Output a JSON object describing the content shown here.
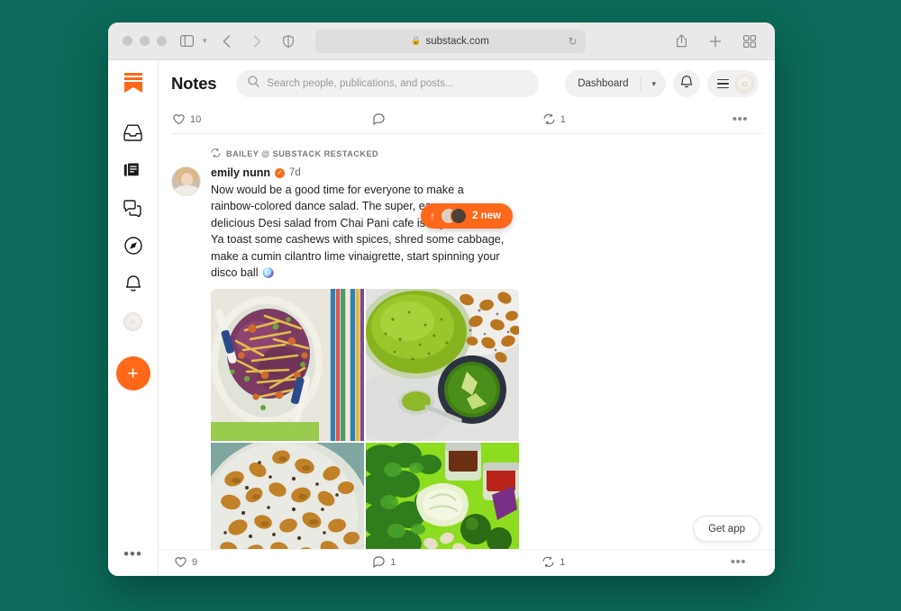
{
  "browser": {
    "url": "substack.com",
    "lock_icon": "lock-icon",
    "reload_icon": "reload-icon",
    "sidebar_toggle_icon": "sidebar-toggle-icon",
    "back_icon": "back-arrow-icon",
    "forward_icon": "forward-arrow-icon",
    "shield_icon": "privacy-shield-icon",
    "share_icon": "share-icon",
    "newtab_icon": "plus-icon",
    "tabgrid_icon": "tab-overview-icon"
  },
  "sidebar": {
    "logo": "substack-logo-icon",
    "items": [
      {
        "name": "inbox",
        "icon": "inbox-icon"
      },
      {
        "name": "library",
        "icon": "stack-icon"
      },
      {
        "name": "chat",
        "icon": "chat-bubbles-icon"
      },
      {
        "name": "explore",
        "icon": "compass-icon"
      },
      {
        "name": "activity",
        "icon": "bell-icon"
      },
      {
        "name": "profile",
        "icon": "avatar-icon"
      }
    ],
    "compose_label": "+",
    "more_label": "•••"
  },
  "header": {
    "title": "Notes",
    "search_placeholder": "Search people, publications, and posts...",
    "search_icon": "search-icon",
    "dashboard_label": "Dashboard",
    "dashboard_chevron": "▾",
    "bell_icon": "bell-icon",
    "menu_icon": "hamburger-icon",
    "avatar_icon": "user-avatar"
  },
  "new_notes_pill": {
    "arrow": "↑",
    "label": "2 new"
  },
  "top_actions": {
    "like_count": "10",
    "comment_count": "",
    "restack_count": "1",
    "more": "•••"
  },
  "post": {
    "restack_notice": "BAILEY @ SUBSTACK RESTACKED",
    "restack_icon": "restack-icon",
    "author": "emily nunn",
    "verified_mark": "✓",
    "timestamp": "7d",
    "body": "Now would be a good time for everyone to make a rainbow-colored dance salad. The super, easy super delicious Desi salad from Chai Pani cafe is a good choice. Ya toast some cashews with spices, shred some cabbage, make a cumin cilantro lime vinaigrette, start spinning your disco ball ",
    "body_emoji": "🪩",
    "images": [
      {
        "alt": "rainbow cabbage dance salad on white plate with striped cloth"
      },
      {
        "alt": "green cilantro lime vinaigrette in bowl beside roasted cashews"
      },
      {
        "alt": "spiced toasted cashews scattered on pale plate"
      },
      {
        "alt": "fresh ingredients cilantro cabbage cashews limes red onion on green background"
      }
    ],
    "actions": {
      "like_count": "9",
      "comment_count": "1",
      "restack_count": "1",
      "more": "•••"
    }
  },
  "get_app_label": "Get app",
  "colors": {
    "accent": "#ff6719",
    "desktop_bg": "#0b6a59",
    "titlebar_bg": "#e9e9e7",
    "chip_bg": "#f2f1ef"
  }
}
